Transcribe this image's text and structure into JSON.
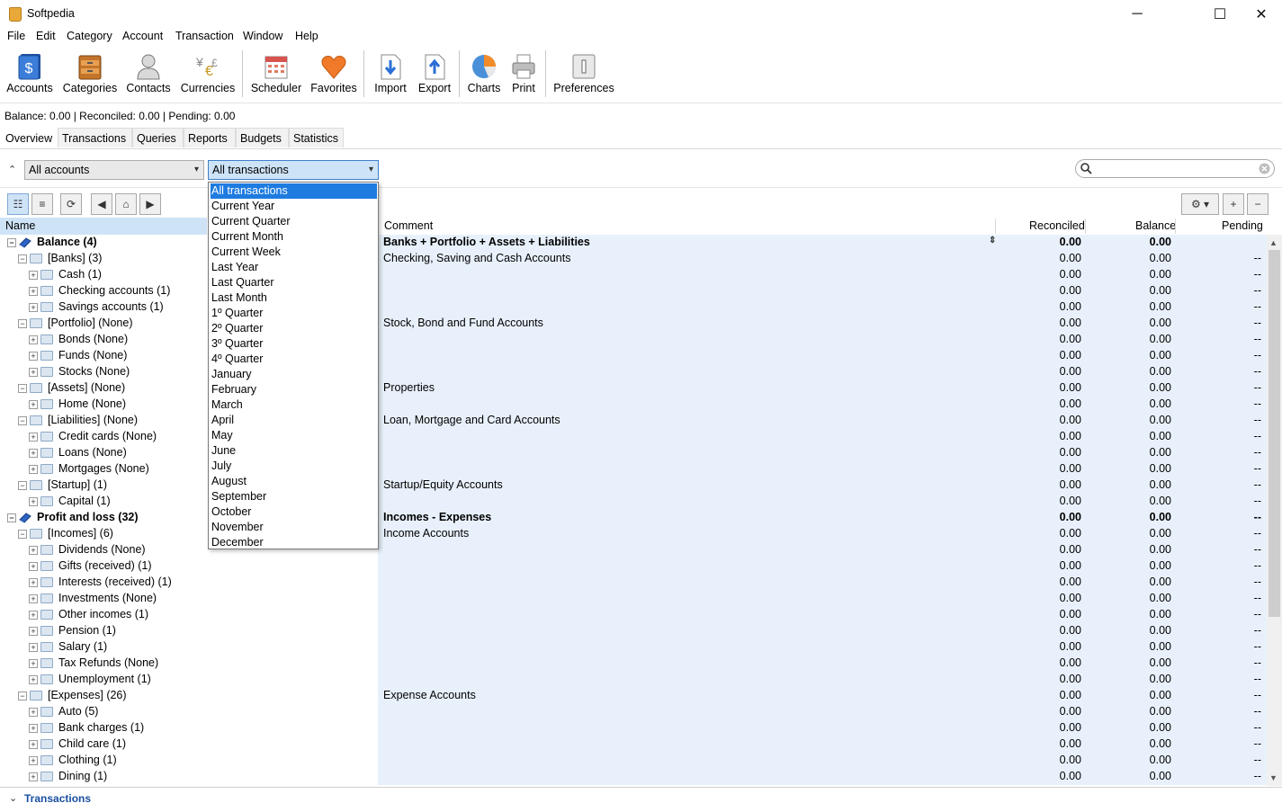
{
  "window": {
    "title": "Softpedia",
    "controls": {
      "minimize": "─",
      "maximize": "☐",
      "close": "✕"
    }
  },
  "menu": [
    "File",
    "Edit",
    "Category",
    "Account",
    "Transaction",
    "Window",
    "Help"
  ],
  "toolbar": [
    {
      "label": "Accounts",
      "icon": "accounts-icon"
    },
    {
      "label": "Categories",
      "icon": "categories-icon"
    },
    {
      "label": "Contacts",
      "icon": "contacts-icon"
    },
    {
      "label": "Currencies",
      "icon": "currencies-icon"
    },
    {
      "label": "Scheduler",
      "icon": "scheduler-icon"
    },
    {
      "label": "Favorites",
      "icon": "favorites-icon"
    },
    {
      "label": "Import",
      "icon": "import-icon"
    },
    {
      "label": "Export",
      "icon": "export-icon"
    },
    {
      "label": "Charts",
      "icon": "charts-icon"
    },
    {
      "label": "Print",
      "icon": "print-icon"
    },
    {
      "label": "Preferences",
      "icon": "preferences-icon"
    }
  ],
  "status_line": "Balance: 0.00 | Reconciled: 0.00 | Pending: 0.00",
  "tabs": [
    "Overview",
    "Transactions",
    "Queries",
    "Reports",
    "Budgets",
    "Statistics"
  ],
  "active_tab": "Overview",
  "filters": {
    "accounts": "All accounts",
    "period": "All transactions"
  },
  "columns": {
    "name": "Name",
    "comment": "Comment",
    "reconciled": "Reconciled",
    "balance": "Balance",
    "pending": "Pending"
  },
  "rows": [
    {
      "level": 0,
      "icon": "book",
      "name": "Balance (4)",
      "comment": "Banks + Portfolio + Assets + Liabilities",
      "rec": "0.00",
      "bal": "0.00",
      "pen": "",
      "bold": true
    },
    {
      "level": 1,
      "icon": "folder",
      "name": "[Banks] (3)",
      "comment": "Checking, Saving and Cash Accounts",
      "rec": "0.00",
      "bal": "0.00",
      "pen": "--"
    },
    {
      "level": 2,
      "icon": "folder",
      "name": "Cash (1)",
      "comment": "",
      "rec": "0.00",
      "bal": "0.00",
      "pen": "--"
    },
    {
      "level": 2,
      "icon": "folder",
      "name": "Checking accounts (1)",
      "comment": "",
      "rec": "0.00",
      "bal": "0.00",
      "pen": "--"
    },
    {
      "level": 2,
      "icon": "folder",
      "name": "Savings accounts (1)",
      "comment": "",
      "rec": "0.00",
      "bal": "0.00",
      "pen": "--"
    },
    {
      "level": 1,
      "icon": "folder",
      "name": "[Portfolio] (None)",
      "comment": "Stock, Bond and Fund Accounts",
      "rec": "0.00",
      "bal": "0.00",
      "pen": "--"
    },
    {
      "level": 2,
      "icon": "folder",
      "name": "Bonds (None)",
      "comment": "",
      "rec": "0.00",
      "bal": "0.00",
      "pen": "--"
    },
    {
      "level": 2,
      "icon": "folder",
      "name": "Funds (None)",
      "comment": "",
      "rec": "0.00",
      "bal": "0.00",
      "pen": "--"
    },
    {
      "level": 2,
      "icon": "folder",
      "name": "Stocks (None)",
      "comment": "",
      "rec": "0.00",
      "bal": "0.00",
      "pen": "--"
    },
    {
      "level": 1,
      "icon": "folder",
      "name": "[Assets] (None)",
      "comment": "Properties",
      "rec": "0.00",
      "bal": "0.00",
      "pen": "--"
    },
    {
      "level": 2,
      "icon": "folder",
      "name": "Home (None)",
      "comment": "",
      "rec": "0.00",
      "bal": "0.00",
      "pen": "--"
    },
    {
      "level": 1,
      "icon": "folder",
      "name": "[Liabilities] (None)",
      "comment": "Loan, Mortgage and Card Accounts",
      "rec": "0.00",
      "bal": "0.00",
      "pen": "--"
    },
    {
      "level": 2,
      "icon": "folder",
      "name": "Credit cards (None)",
      "comment": "",
      "rec": "0.00",
      "bal": "0.00",
      "pen": "--"
    },
    {
      "level": 2,
      "icon": "folder",
      "name": "Loans (None)",
      "comment": "",
      "rec": "0.00",
      "bal": "0.00",
      "pen": "--"
    },
    {
      "level": 2,
      "icon": "folder",
      "name": "Mortgages (None)",
      "comment": "",
      "rec": "0.00",
      "bal": "0.00",
      "pen": "--"
    },
    {
      "level": 1,
      "icon": "folder",
      "name": "[Startup] (1)",
      "comment": "Startup/Equity Accounts",
      "rec": "0.00",
      "bal": "0.00",
      "pen": "--"
    },
    {
      "level": 2,
      "icon": "folder",
      "name": "Capital (1)",
      "comment": "",
      "rec": "0.00",
      "bal": "0.00",
      "pen": "--"
    },
    {
      "level": 0,
      "icon": "book",
      "name": "Profit and loss (32)",
      "comment": "Incomes - Expenses",
      "rec": "0.00",
      "bal": "0.00",
      "pen": "--",
      "bold": true
    },
    {
      "level": 1,
      "icon": "folder",
      "name": "[Incomes] (6)",
      "comment": "Income Accounts",
      "rec": "0.00",
      "bal": "0.00",
      "pen": "--"
    },
    {
      "level": 2,
      "icon": "folder",
      "name": "Dividends (None)",
      "comment": "",
      "rec": "0.00",
      "bal": "0.00",
      "pen": "--"
    },
    {
      "level": 2,
      "icon": "folder",
      "name": "Gifts (received) (1)",
      "comment": "",
      "rec": "0.00",
      "bal": "0.00",
      "pen": "--"
    },
    {
      "level": 2,
      "icon": "folder",
      "name": "Interests (received) (1)",
      "comment": "",
      "rec": "0.00",
      "bal": "0.00",
      "pen": "--"
    },
    {
      "level": 2,
      "icon": "folder",
      "name": "Investments (None)",
      "comment": "",
      "rec": "0.00",
      "bal": "0.00",
      "pen": "--"
    },
    {
      "level": 2,
      "icon": "folder",
      "name": "Other incomes (1)",
      "comment": "",
      "rec": "0.00",
      "bal": "0.00",
      "pen": "--"
    },
    {
      "level": 2,
      "icon": "folder",
      "name": "Pension (1)",
      "comment": "",
      "rec": "0.00",
      "bal": "0.00",
      "pen": "--"
    },
    {
      "level": 2,
      "icon": "folder",
      "name": "Salary (1)",
      "comment": "",
      "rec": "0.00",
      "bal": "0.00",
      "pen": "--"
    },
    {
      "level": 2,
      "icon": "folder",
      "name": "Tax Refunds (None)",
      "comment": "",
      "rec": "0.00",
      "bal": "0.00",
      "pen": "--"
    },
    {
      "level": 2,
      "icon": "folder",
      "name": "Unemployment (1)",
      "comment": "",
      "rec": "0.00",
      "bal": "0.00",
      "pen": "--"
    },
    {
      "level": 1,
      "icon": "folder",
      "name": "[Expenses] (26)",
      "comment": "Expense Accounts",
      "rec": "0.00",
      "bal": "0.00",
      "pen": "--"
    },
    {
      "level": 2,
      "icon": "folder",
      "name": "Auto (5)",
      "comment": "",
      "rec": "0.00",
      "bal": "0.00",
      "pen": "--"
    },
    {
      "level": 2,
      "icon": "folder",
      "name": "Bank charges (1)",
      "comment": "",
      "rec": "0.00",
      "bal": "0.00",
      "pen": "--"
    },
    {
      "level": 2,
      "icon": "folder",
      "name": "Child care (1)",
      "comment": "",
      "rec": "0.00",
      "bal": "0.00",
      "pen": "--"
    },
    {
      "level": 2,
      "icon": "folder",
      "name": "Clothing (1)",
      "comment": "",
      "rec": "0.00",
      "bal": "0.00",
      "pen": "--"
    },
    {
      "level": 2,
      "icon": "folder",
      "name": "Dining (1)",
      "comment": "",
      "rec": "0.00",
      "bal": "0.00",
      "pen": "--"
    }
  ],
  "dropdown_options": [
    "All transactions",
    "Current Year",
    "Current Quarter",
    "Current Month",
    "Current Week",
    "Last Year",
    "Last Quarter",
    "Last Month",
    "1º Quarter",
    "2º Quarter",
    "3º Quarter",
    "4º Quarter",
    "January",
    "February",
    "March",
    "April",
    "May",
    "June",
    "July",
    "August",
    "September",
    "October",
    "November",
    "December"
  ],
  "bottom_panel": {
    "label": "Transactions"
  },
  "colors": {
    "accent": "#1e7be0",
    "row_highlight": "#e8f1fb",
    "bottom_label": "#1a4fa0"
  }
}
